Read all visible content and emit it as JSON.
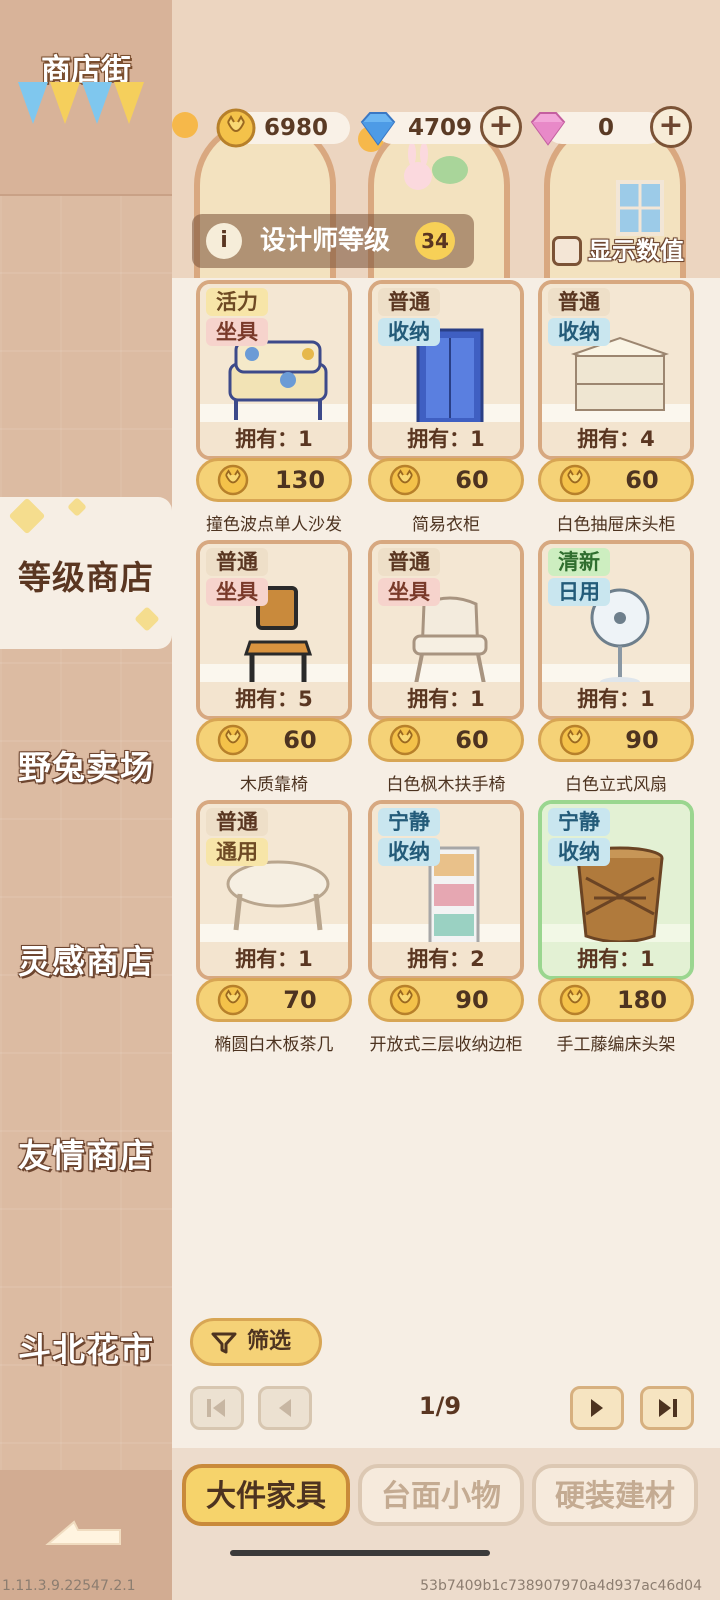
{
  "sidebar": {
    "title": "商店街",
    "bunting_colors": [
      "#7fc7ee",
      "#f5cf5c",
      "#7fc7ee",
      "#f5cf5c"
    ],
    "items": [
      {
        "label": "等级商店",
        "active": true
      },
      {
        "label": "野兔卖场",
        "active": false
      },
      {
        "label": "灵感商店",
        "active": false
      },
      {
        "label": "友情商店",
        "active": false
      },
      {
        "label": "斗北花市",
        "active": false
      }
    ]
  },
  "currency": {
    "coins": "6980",
    "diamonds": "4709",
    "gems": "0"
  },
  "designer": {
    "label": "设计师等级",
    "level": "34"
  },
  "show_values_label": "显示数值",
  "items": [
    {
      "tags": [
        "活力",
        "坐具"
      ],
      "tag_styles": [
        "gold",
        "pink"
      ],
      "owned": "拥有：1",
      "price": "130",
      "name": "撞色波点单人沙发",
      "icon": "sofa-icon"
    },
    {
      "tags": [
        "普通",
        "收纳"
      ],
      "tag_styles": [
        "plain",
        "cyan"
      ],
      "owned": "拥有：1",
      "price": "60",
      "name": "简易衣柜",
      "icon": "wardrobe-icon"
    },
    {
      "tags": [
        "普通",
        "收纳"
      ],
      "tag_styles": [
        "plain",
        "cyan"
      ],
      "owned": "拥有：4",
      "price": "60",
      "name": "白色抽屉床头柜",
      "icon": "nightstand-icon"
    },
    {
      "tags": [
        "普通",
        "坐具"
      ],
      "tag_styles": [
        "plain",
        "pink"
      ],
      "owned": "拥有：5",
      "price": "60",
      "name": "木质靠椅",
      "icon": "chair-icon"
    },
    {
      "tags": [
        "普通",
        "坐具"
      ],
      "tag_styles": [
        "plain",
        "pink"
      ],
      "owned": "拥有：1",
      "price": "60",
      "name": "白色枫木扶手椅",
      "icon": "armchair-icon"
    },
    {
      "tags": [
        "清新",
        "日用"
      ],
      "tag_styles": [
        "green",
        "cyan"
      ],
      "owned": "拥有：1",
      "price": "90",
      "name": "白色立式风扇",
      "icon": "fan-icon"
    },
    {
      "tags": [
        "普通",
        "通用"
      ],
      "tag_styles": [
        "plain",
        "gold"
      ],
      "owned": "拥有：1",
      "price": "70",
      "name": "椭圆白木板茶几",
      "icon": "coffee-table-icon"
    },
    {
      "tags": [
        "宁静",
        "收纳"
      ],
      "tag_styles": [
        "cyan",
        "cyan"
      ],
      "owned": "拥有：2",
      "price": "90",
      "name": "开放式三层收纳边柜",
      "icon": "shelf-icon"
    },
    {
      "tags": [
        "宁静",
        "收纳"
      ],
      "tag_styles": [
        "cyan",
        "cyan"
      ],
      "owned": "拥有：1",
      "price": "180",
      "name": "手工藤编床头架",
      "icon": "rattan-basket-icon",
      "highlighted": true
    }
  ],
  "filter_label": "筛选",
  "pagination": {
    "current": "1/9"
  },
  "tabs": [
    {
      "label": "大件家具",
      "active": true
    },
    {
      "label": "台面小物",
      "active": false
    },
    {
      "label": "硬装建材",
      "active": false
    }
  ],
  "version": "1.11.3.9.22547.2.1",
  "build_id": "53b7409b1c738907970a4d937ac46d04"
}
